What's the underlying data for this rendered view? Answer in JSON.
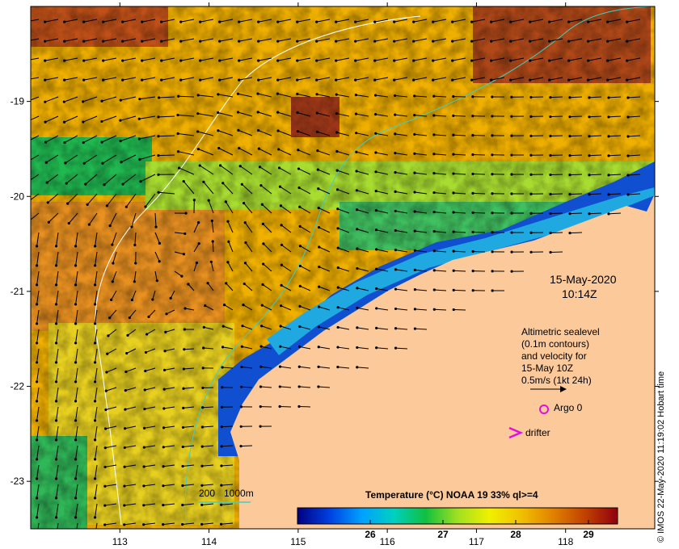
{
  "colors": {
    "land": "#fbc99a",
    "frame": "#000000",
    "contour_200": "#40d0c0",
    "contour_1000": "#ffffff",
    "argo": "#e010e0",
    "drifter": "#e010e0"
  },
  "map": {
    "lon_range": [
      112.0,
      119.0
    ],
    "lat_range": [
      -23.5,
      -18.0
    ],
    "lon_ticks": [
      113,
      114,
      115,
      116,
      117,
      118
    ],
    "lat_ticks": [
      -19,
      -20,
      -21,
      -22,
      -23
    ]
  },
  "date": "15-May-2020",
  "time": "10:14Z",
  "legend_text": {
    "line1": "Altimetric sealevel",
    "line2": "(0.1m contours)",
    "line3": "and velocity for",
    "line4": "15-May 10Z",
    "line5": "0.5m/s (1kt 24h)"
  },
  "argo_label": "Argo 0",
  "drifter_label": "drifter",
  "isobath_legend": {
    "a": "200",
    "b": "1000m"
  },
  "colorbar": {
    "title": "Temperature (°C) NOAA 19 33% ql>=4",
    "min": 25.0,
    "max": 29.4,
    "ticks": [
      26,
      27,
      28,
      29
    ],
    "stops": [
      "#000080",
      "#0040e0",
      "#00a0ff",
      "#00d0c0",
      "#10c040",
      "#a0e020",
      "#f0f000",
      "#f0c000",
      "#e08000",
      "#c04000",
      "#900010"
    ]
  },
  "credit": "© IMOS 22-May-2020 11:19:02 Hobart time"
}
